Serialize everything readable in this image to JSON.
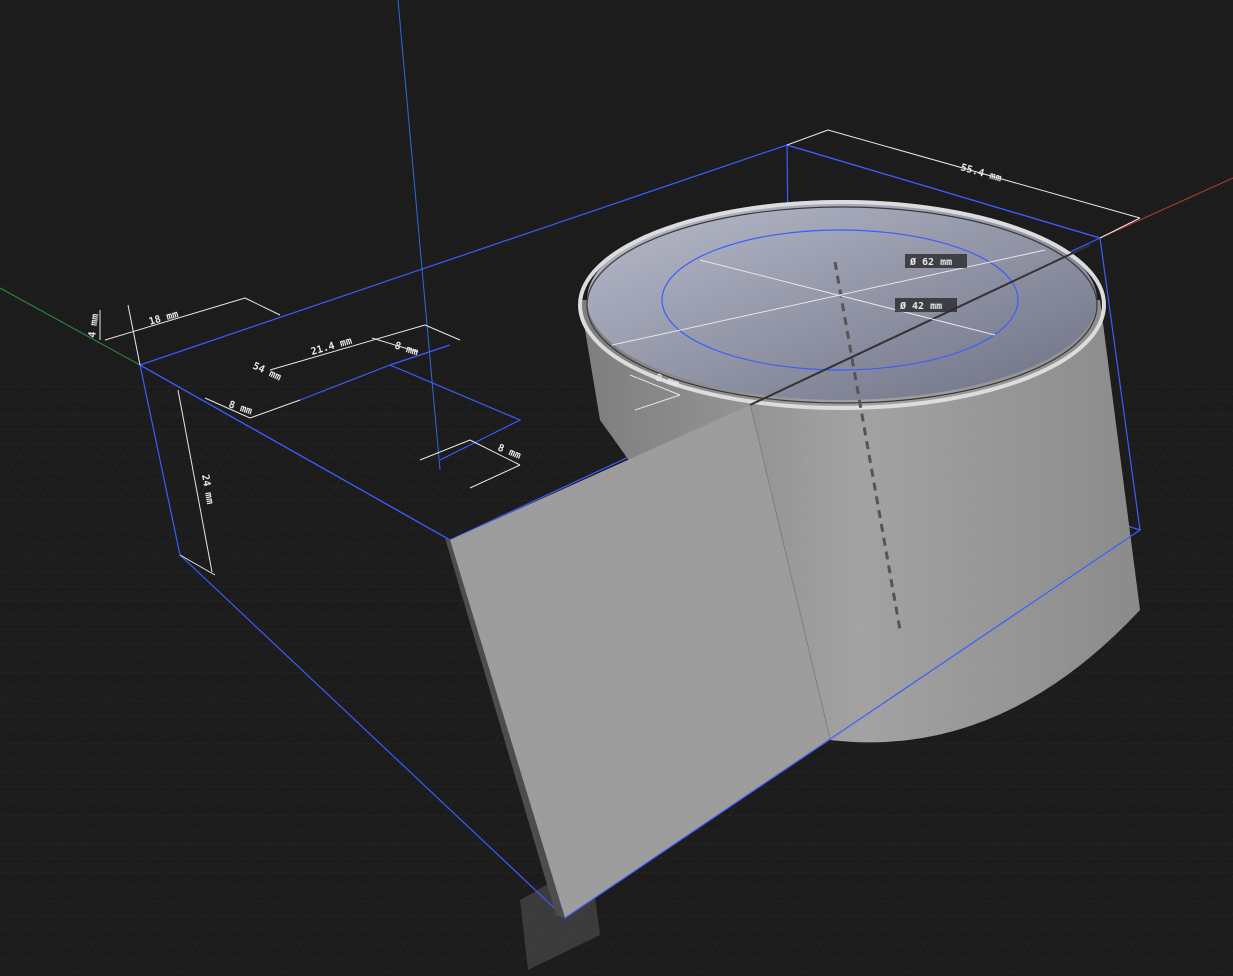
{
  "viewport": {
    "background": "#1c1c1c",
    "grid_color": "#2a2a2a",
    "axes": {
      "x_color": "#c0392b",
      "y_color": "#2e8b3a",
      "z_color": "#2d6bd6"
    }
  },
  "model": {
    "selection_color": "#3b5cff",
    "body_color": "#9a9a9a"
  },
  "dimensions": {
    "overall_length": "55.4 mm",
    "outer_diameter": "Ø 62 mm",
    "inner_diameter": "Ø 42 mm",
    "slot_offset": "21.4 mm",
    "slot_width_a": "8 mm",
    "slot_width_b": "8 mm",
    "slot_width_c": "8 mm",
    "slot_width_d": "8 mm",
    "edge_offset": "18 mm",
    "small_height": "4 mm",
    "depth": "54 mm",
    "height": "24 mm"
  }
}
